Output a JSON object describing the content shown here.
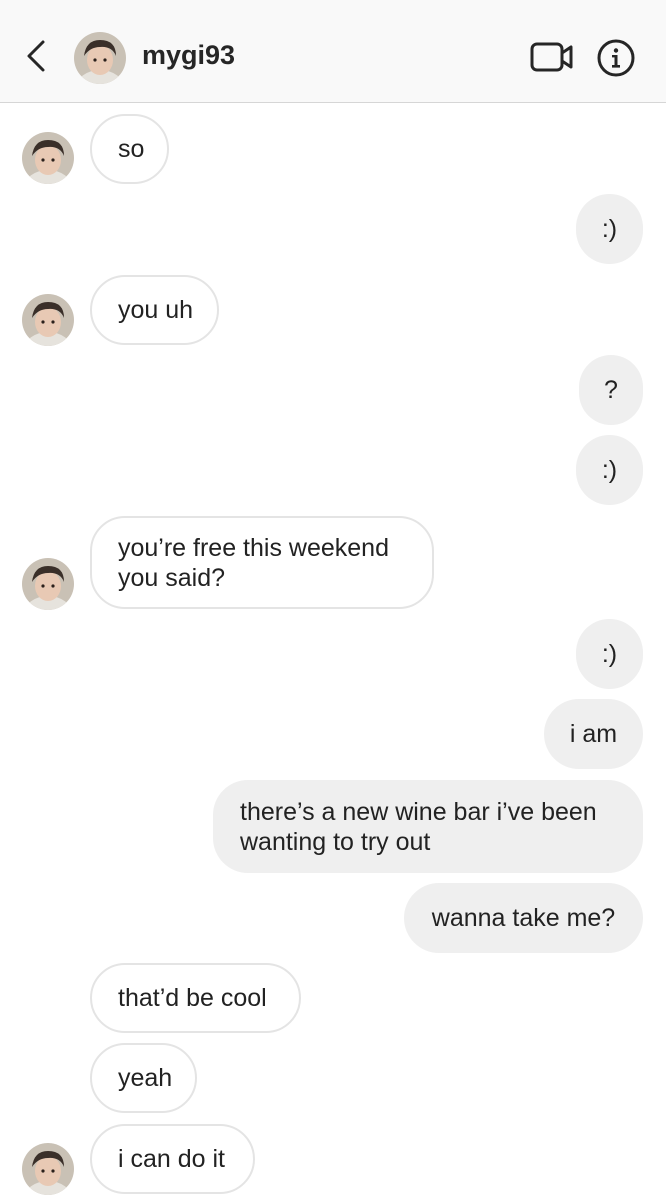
{
  "header": {
    "username": "mygi93",
    "back_icon": "chevron-left-icon",
    "video_icon": "video-camera-icon",
    "info_icon": "info-circle-icon"
  },
  "messages": [
    {
      "from": "them",
      "text": "so"
    },
    {
      "from": "me",
      "text": ":)"
    },
    {
      "from": "them",
      "text": "you uh"
    },
    {
      "from": "me",
      "text": "?"
    },
    {
      "from": "me",
      "text": ":)"
    },
    {
      "from": "them",
      "lines": [
        "you’re free this weekend",
        "you said?"
      ]
    },
    {
      "from": "me",
      "text": ":)"
    },
    {
      "from": "me",
      "text": "i am"
    },
    {
      "from": "me",
      "lines": [
        "there’s a new wine bar i’ve been",
        "wanting to try out"
      ]
    },
    {
      "from": "me",
      "text": "wanna take me?"
    },
    {
      "from": "them",
      "text": "that’d be cool"
    },
    {
      "from": "them",
      "text": "yeah"
    },
    {
      "from": "them",
      "text": "i can do it"
    }
  ],
  "colors": {
    "header_bg": "#f9f9f9",
    "outgoing_bubble": "#efefef",
    "incoming_border": "#e4e4e4",
    "text": "#222222"
  }
}
